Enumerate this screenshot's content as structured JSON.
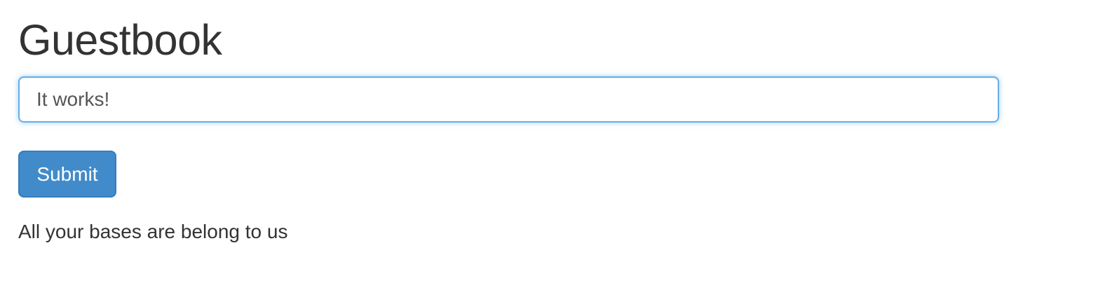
{
  "page": {
    "title": "Guestbook"
  },
  "form": {
    "entry_value": "It works!",
    "submit_label": "Submit"
  },
  "entries": [
    "All your bases are belong to us"
  ],
  "colors": {
    "primary": "#428bca",
    "focus_border": "#66afe9",
    "text": "#333333"
  }
}
